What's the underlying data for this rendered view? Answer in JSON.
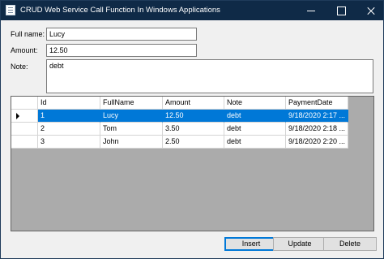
{
  "window": {
    "title": "CRUD Web Service Call Function In Windows Applications",
    "accent_color": "#0f2a47",
    "controls": {
      "minimize_icon": "minimize-icon",
      "maximize_icon": "maximize-icon",
      "close_icon": "close-icon"
    }
  },
  "form": {
    "fullname_label": "Full name:",
    "fullname_value": "Lucy",
    "amount_label": "Amount:",
    "amount_value": "12.50",
    "note_label": "Note:",
    "note_value": "debt"
  },
  "grid": {
    "columns": [
      "Id",
      "FullName",
      "Amount",
      "Note",
      "PaymentDate"
    ],
    "rows": [
      {
        "Id": "1",
        "FullName": "Lucy",
        "Amount": "12.50",
        "Note": "debt",
        "PaymentDate": "9/18/2020 2:17 ...",
        "selected": true
      },
      {
        "Id": "2",
        "FullName": "Tom",
        "Amount": "3.50",
        "Note": "debt",
        "PaymentDate": "9/18/2020 2:18 ...",
        "selected": false
      },
      {
        "Id": "3",
        "FullName": "John",
        "Amount": "2.50",
        "Note": "debt",
        "PaymentDate": "9/18/2020 2:20 ...",
        "selected": false
      }
    ],
    "selection_color": "#0078d7"
  },
  "buttons": {
    "insert": "Insert",
    "update": "Update",
    "delete": "Delete"
  }
}
